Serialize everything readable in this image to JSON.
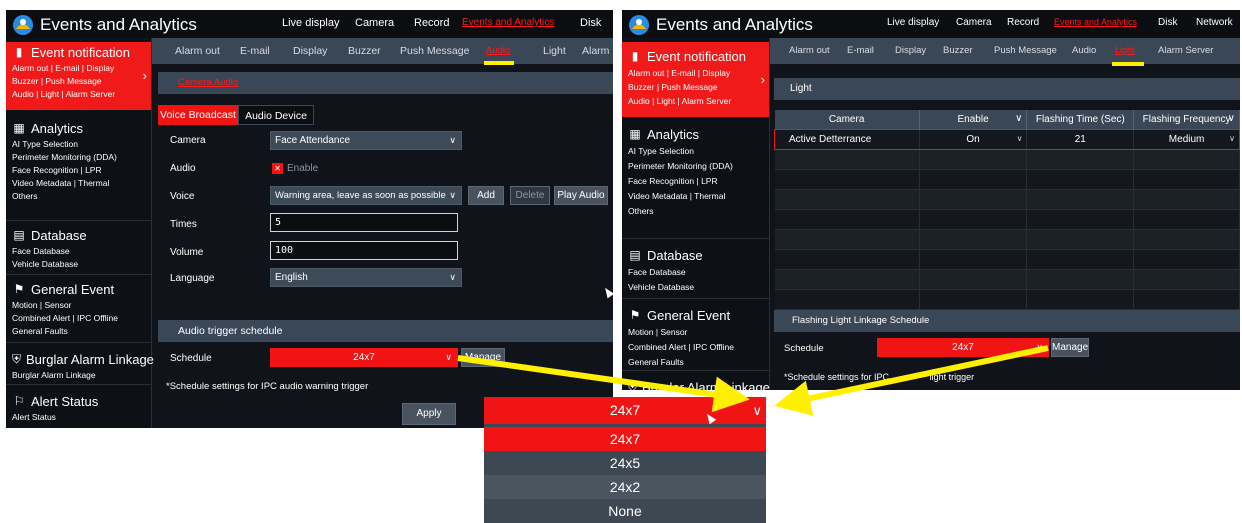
{
  "brand": "Events and Analytics",
  "left": {
    "nav": [
      "Live display",
      "Camera",
      "Record",
      "Events and Analytics",
      "Disk"
    ],
    "tabs": [
      "Alarm out",
      "E-mail",
      "Display",
      "Buzzer",
      "Push Message",
      "Audio",
      "Light",
      "Alarm S"
    ],
    "section_title": "Camera Audio",
    "subtabs": [
      "Voice Broadcast",
      "Audio Device"
    ],
    "form": {
      "camera_label": "Camera",
      "camera_value": "Face Attendance",
      "audio_label": "Audio",
      "audio_enable": "Enable",
      "voice_label": "Voice",
      "voice_value": "Warning area, leave as soon as possible",
      "add": "Add",
      "delete": "Delete",
      "play": "Play Audio",
      "times_label": "Times",
      "times_value": "5",
      "volume_label": "Volume",
      "volume_value": "100",
      "language_label": "Language",
      "language_value": "English"
    },
    "schedule_section": "Audio trigger schedule",
    "schedule_label": "Schedule",
    "schedule_value": "24x7",
    "manage": "Manage",
    "note": "*Schedule settings for IPC audio warning trigger",
    "apply": "Apply"
  },
  "right": {
    "nav": [
      "Live display",
      "Camera",
      "Record",
      "Events and Analytics",
      "Disk",
      "Network"
    ],
    "tabs": [
      "Alarm out",
      "E-mail",
      "Display",
      "Buzzer",
      "Push Message",
      "Audio",
      "Light",
      "Alarm Server"
    ],
    "section_title": "Light",
    "table_headers": [
      "Camera",
      "Enable",
      "Flashing Time (Sec)",
      "Flashing Frequency"
    ],
    "table_row": [
      "Active Detterrance",
      "On",
      "21",
      "Medium"
    ],
    "schedule_section": "Flashing Light Linkage Schedule",
    "schedule_label": "Schedule",
    "schedule_value": "24x7",
    "manage": "Manage",
    "note_a": "*Schedule settings for IPC ",
    "note_b": "light trigger"
  },
  "sidebar": {
    "event": {
      "title": "Event notification",
      "l1": "Alarm out | E-mail | Display",
      "l2": "Buzzer | Push Message",
      "l3": "Audio | Light | Alarm Server"
    },
    "analytics": {
      "title": "Analytics",
      "l1": "AI Type Selection",
      "l2": "Perimeter Monitoring (DDA)",
      "l3": "Face Recognition | LPR",
      "l4": "Video Metadata | Thermal",
      "l5": "Others"
    },
    "database": {
      "title": "Database",
      "l1": "Face Database",
      "l2": "Vehicle Database"
    },
    "general": {
      "title": "General Event",
      "l1": "Motion | Sensor",
      "l2": "Combined Alert | IPC Offline",
      "l3": "General Faults"
    },
    "burglar": {
      "title": "Burglar Alarm Linkage",
      "l1": "Burglar Alarm Linkage"
    },
    "alert": {
      "title": "Alert Status",
      "l1": "Alert Status"
    }
  },
  "dropdown": {
    "selected": "24x7",
    "options": [
      "24x7",
      "24x5",
      "24x2",
      "None"
    ]
  },
  "colors": {
    "accent": "#f01414",
    "panel": "#10141a",
    "bar": "#3a4756",
    "highlight": "#ffef00"
  }
}
